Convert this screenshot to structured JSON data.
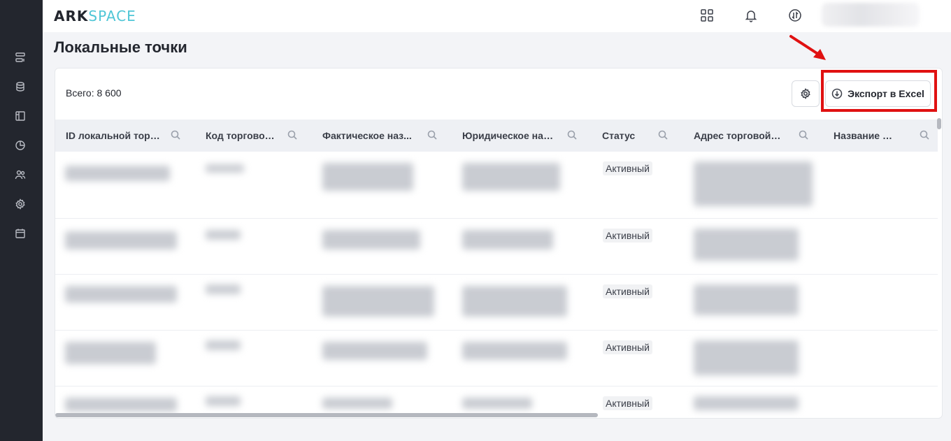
{
  "logo": {
    "part1": "ARK",
    "part2": "SPACE"
  },
  "header": {
    "icons": [
      "apps-grid-icon",
      "bell-icon",
      "transfer-icon"
    ]
  },
  "sidebar": {
    "items": [
      "dashboard-icon",
      "database-icon",
      "layout-icon",
      "pie-chart-icon",
      "users-icon",
      "gear-icon",
      "calendar-icon"
    ]
  },
  "page": {
    "title": "Локальные точки"
  },
  "toolbar": {
    "total": "Всего: 8 600",
    "export_label": "Экспорт в Excel"
  },
  "table": {
    "columns": [
      "ID локальной торг...",
      "Код торговой...",
      "Фактическое наз...",
      "Юридическое наз...",
      "Статус",
      "Адрес торговой т...",
      "Название се..."
    ],
    "rows": [
      {
        "status": "Активный"
      },
      {
        "status": "Активный"
      },
      {
        "status": "Активный"
      },
      {
        "status": "Активный"
      },
      {
        "status": "Активный"
      }
    ]
  },
  "colors": {
    "accent": "#4fc6d6",
    "sidebar": "#23262e",
    "annotation": "#e01111"
  }
}
